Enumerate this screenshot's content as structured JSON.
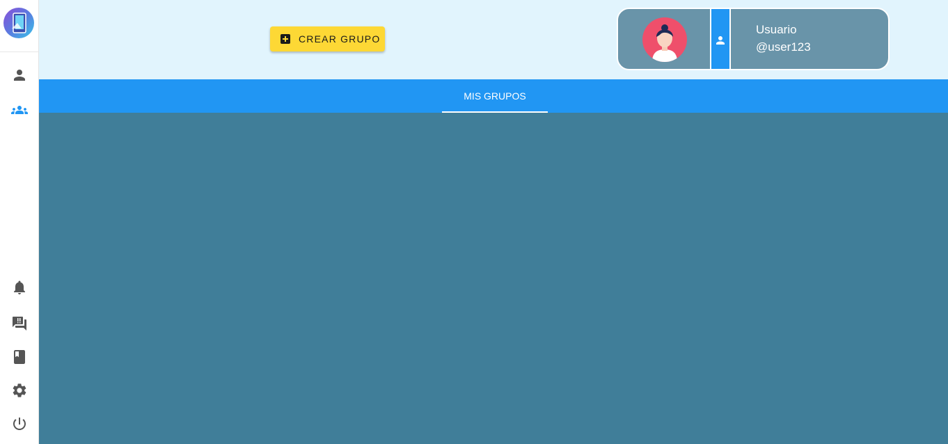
{
  "sidebar": {
    "items": [
      {
        "name": "sidebar-item-profile",
        "icon": "person-icon"
      },
      {
        "name": "sidebar-item-groups",
        "icon": "groups-icon",
        "active": true
      },
      {
        "name": "sidebar-item-notifications",
        "icon": "bell-icon"
      },
      {
        "name": "sidebar-item-questions",
        "icon": "question-answer-icon"
      },
      {
        "name": "sidebar-item-book",
        "icon": "book-icon"
      },
      {
        "name": "sidebar-item-settings",
        "icon": "gear-icon"
      },
      {
        "name": "sidebar-item-logout",
        "icon": "power-icon"
      }
    ]
  },
  "header": {
    "create_group_label": "CREAR GRUPO"
  },
  "user": {
    "name": "Usuario",
    "handle": "@user123"
  },
  "tabs": [
    {
      "label": "MIS GRUPOS",
      "active": true
    }
  ],
  "colors": {
    "accent": "#2196f3",
    "header_bg": "#e1f4fd",
    "create_button": "#fdd835",
    "content_bg": "#407e99",
    "user_card": "#6994a9",
    "avatar_bg": "#ef4f6b"
  }
}
